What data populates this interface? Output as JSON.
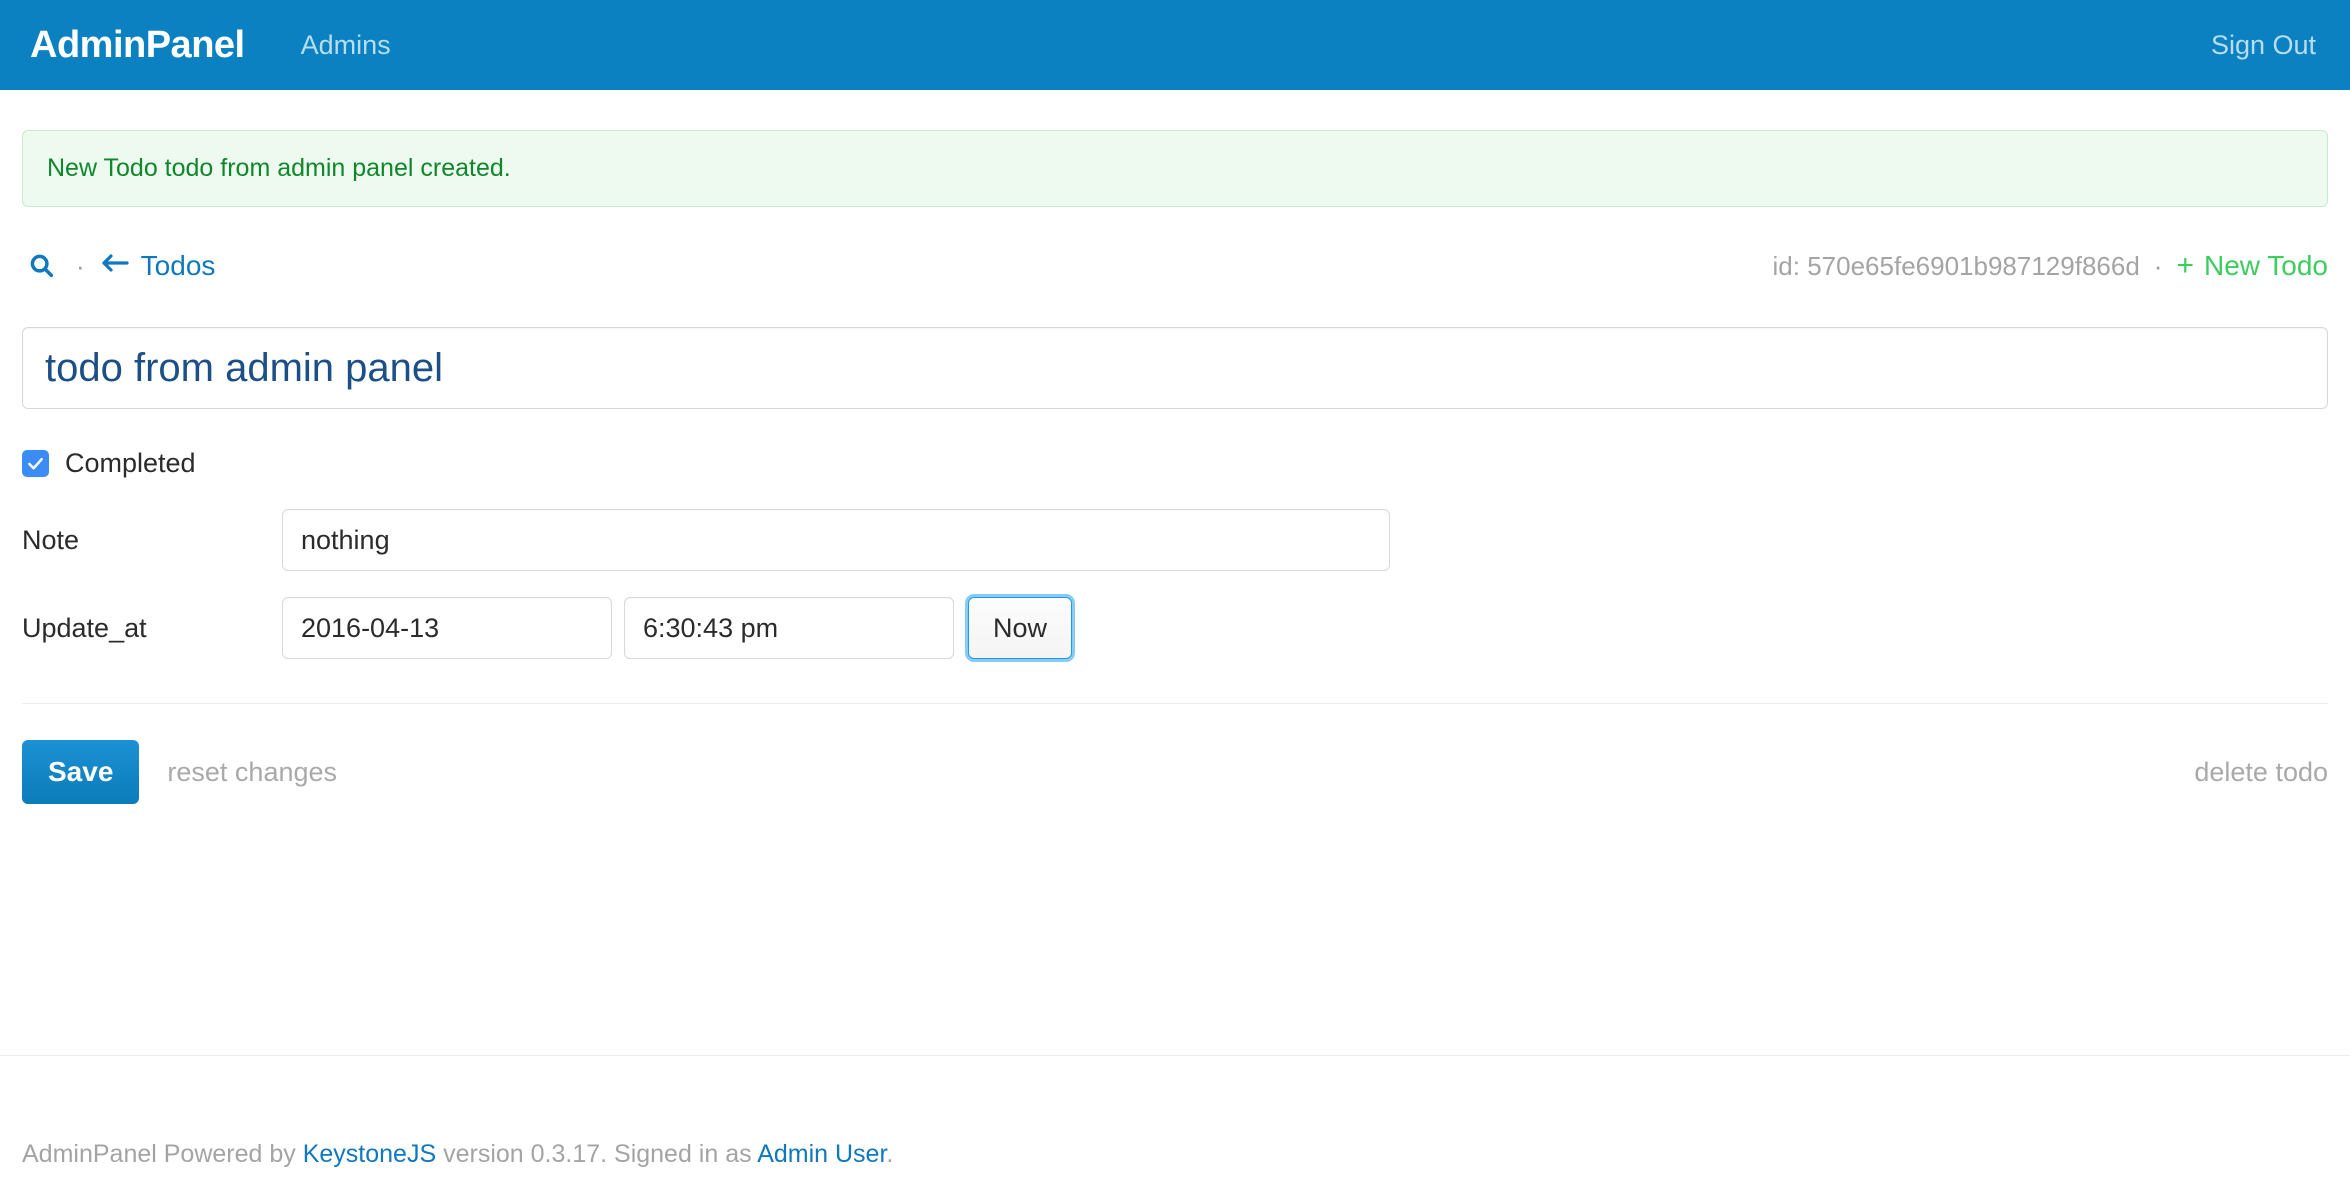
{
  "navbar": {
    "brand": "AdminPanel",
    "links": [
      {
        "label": "Admins",
        "name": "nav-item-admins"
      }
    ],
    "sign_out": "Sign Out",
    "background_color": "#0b81c1"
  },
  "alert": {
    "message": "New Todo todo from admin panel created.",
    "text_color": "#10872c",
    "background_color": "#eefaef",
    "border_color": "#c9ead0"
  },
  "toolbar": {
    "search_icon": "search-icon",
    "separator": "·",
    "back_icon": "arrow-left-icon",
    "back_label": "Todos",
    "id_label": "id: 570e65fe6901b987129f866d",
    "plus_icon": "+",
    "new_item_label": "New Todo",
    "link_color": "#1078be",
    "new_link_color": "#3ecc5f"
  },
  "form": {
    "title_value": "todo from admin panel",
    "title_placeholder": "Name",
    "title_color": "#1c4f86",
    "completed": {
      "label": "Completed",
      "checked": true,
      "accent_color": "#3b8cf5"
    },
    "note": {
      "label": "Note",
      "value": "nothing",
      "placeholder": ""
    },
    "update_at": {
      "label": "Update_at",
      "date_value": "2016-04-13",
      "date_placeholder": "yyyy-mm-dd",
      "time_value": "6:30:43 pm",
      "time_placeholder": "hh:mm:ss am/pm",
      "now_button": "Now",
      "now_focused": true
    }
  },
  "actions": {
    "save_label": "Save",
    "reset_label": "reset changes",
    "delete_label": "delete todo",
    "save_color": "#0b7cb8"
  },
  "footer": {
    "prefix": "AdminPanel Powered by ",
    "keystone_link": "KeystoneJS",
    "middle": " version 0.3.17. Signed in as ",
    "user_link": "Admin User",
    "suffix": ".",
    "link_color": "#1078be"
  }
}
